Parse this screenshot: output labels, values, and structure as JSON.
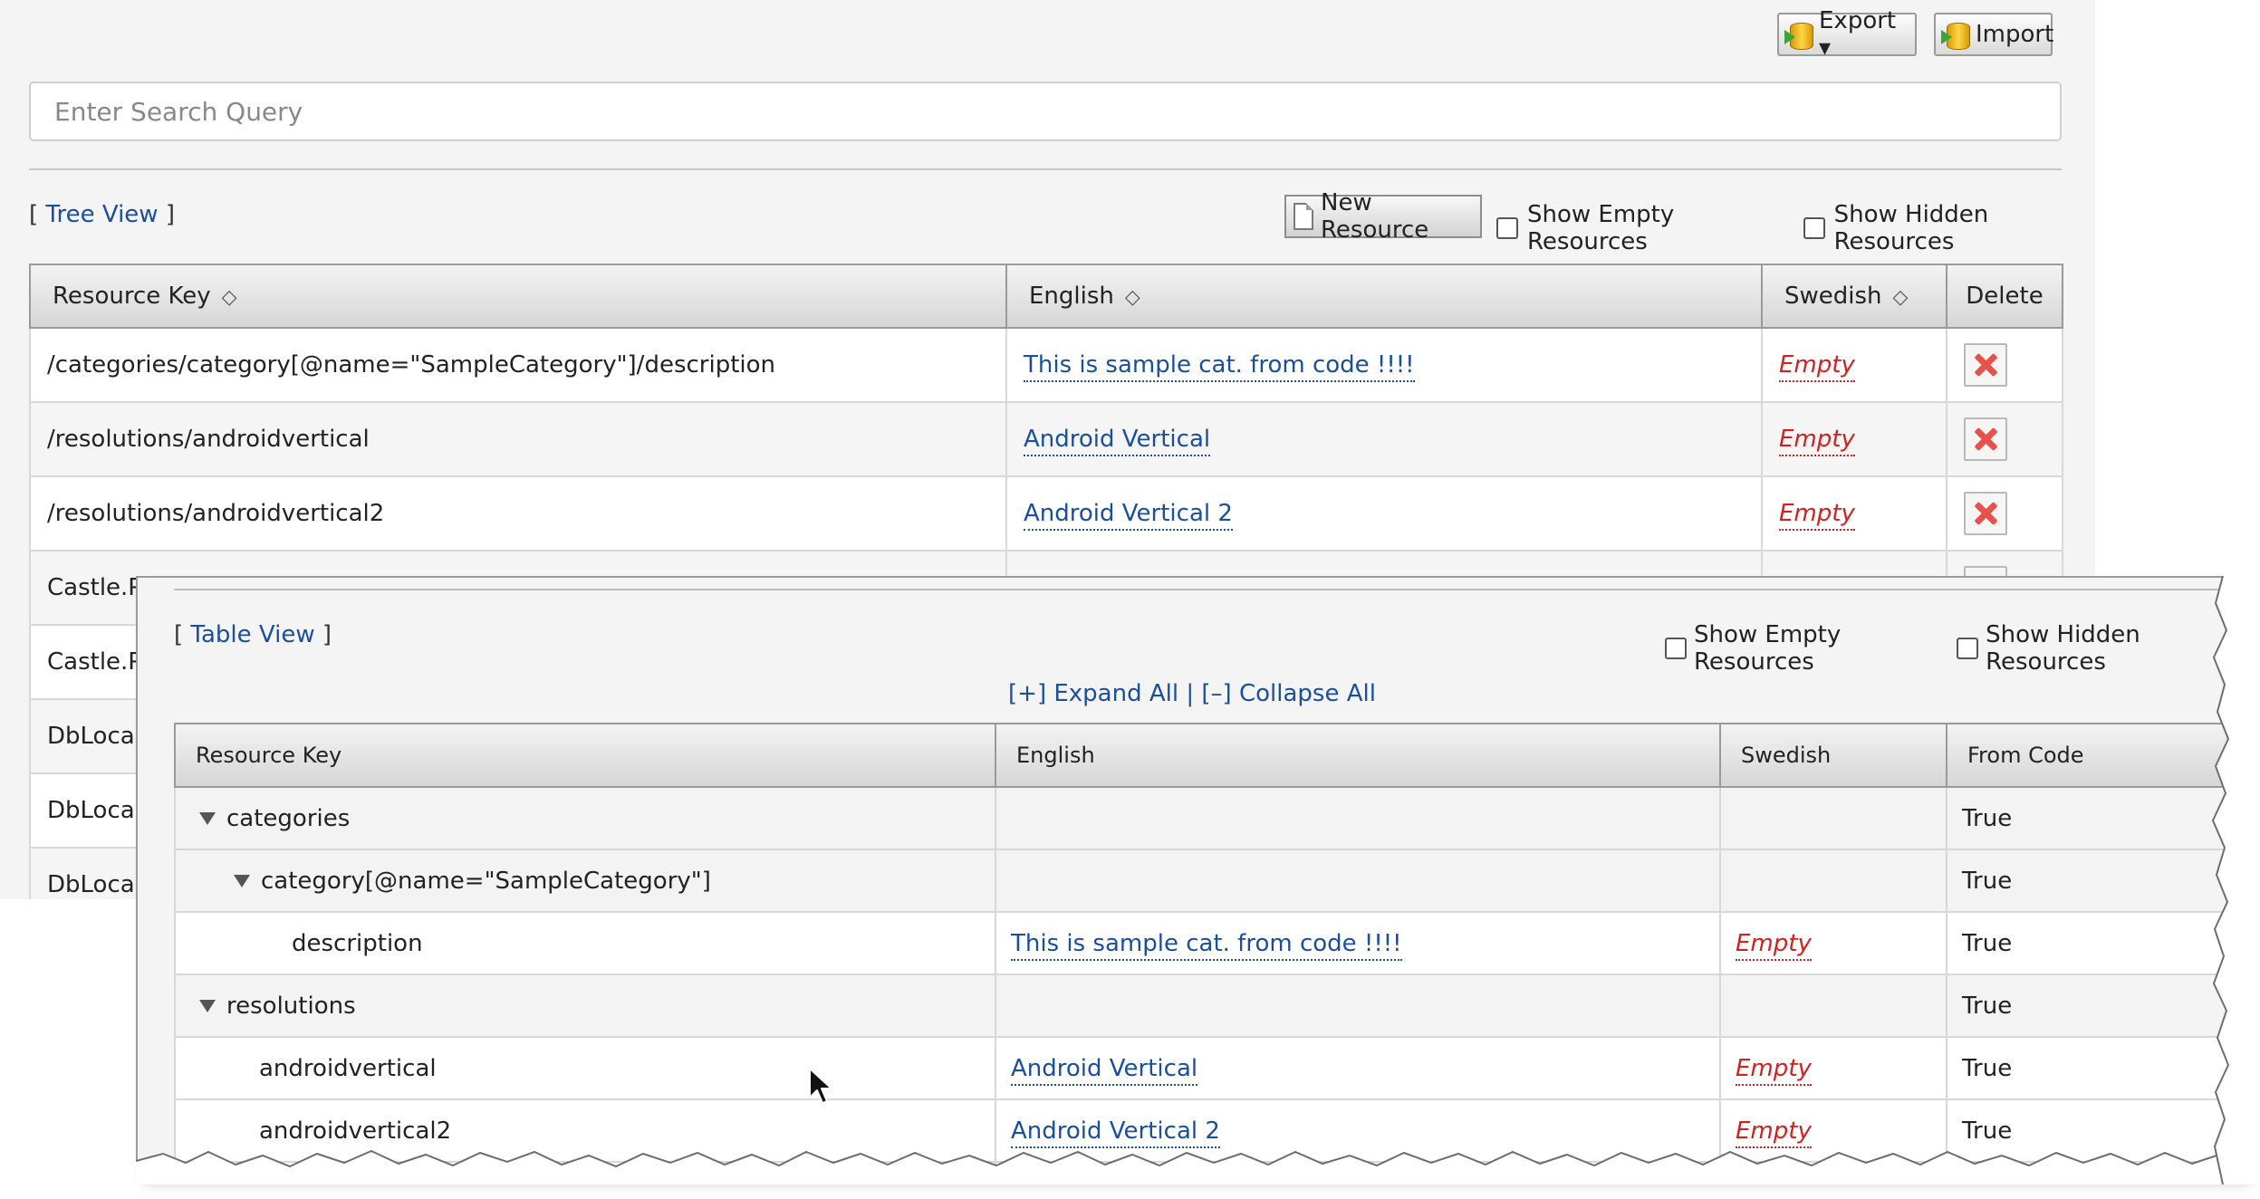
{
  "toolbar": {
    "export_label": "Export ▾",
    "import_label": "Import"
  },
  "search": {
    "placeholder": "Enter Search Query",
    "value": ""
  },
  "table_view": {
    "view_link_open": "[ ",
    "view_link_label": "Tree View",
    "view_link_close": " ]",
    "new_resource_label": "New Resource",
    "show_empty_label": "Show Empty Resources",
    "show_hidden_label": "Show Hidden Resources",
    "columns": [
      "Resource Key",
      "English",
      "Swedish",
      "Delete"
    ],
    "sort_glyph": "◇",
    "rows": [
      {
        "key": "/categories/category[@name=\"SampleCategory\"]/description",
        "english": "This is sample cat. from code !!!!",
        "swedish": "Empty"
      },
      {
        "key": "/resolutions/androidvertical",
        "english": "Android Vertical",
        "swedish": "Empty"
      },
      {
        "key": "/resolutions/androidvertical2",
        "english": "Android Vertical 2",
        "swedish": "Empty"
      },
      {
        "key": "Castle.Pr",
        "english": "",
        "swedish": ""
      },
      {
        "key": "Castle.Pr",
        "english": "",
        "swedish": ""
      },
      {
        "key": "DbLocali",
        "english": "",
        "swedish": ""
      },
      {
        "key": "DbLocali",
        "english": "",
        "swedish": ""
      },
      {
        "key": "DbLocali",
        "english": "",
        "swedish": ""
      }
    ]
  },
  "tree_view": {
    "view_link_open": "[ ",
    "view_link_label": "Table View",
    "view_link_close": " ]",
    "show_empty_label": "Show Empty Resources",
    "show_hidden_label": "Show Hidden Resources",
    "expand_all": "[+] Expand All",
    "separator": " | ",
    "collapse_all": "[–] Collapse All",
    "columns": [
      "Resource Key",
      "English",
      "Swedish",
      "From Code"
    ],
    "rows": [
      {
        "key": "categories",
        "english": "",
        "swedish": "",
        "from_code": "True"
      },
      {
        "key": "category[@name=\"SampleCategory\"]",
        "english": "",
        "swedish": "",
        "from_code": "True"
      },
      {
        "key": "description",
        "english": "This is sample cat. from code !!!!",
        "swedish": "Empty",
        "from_code": "True"
      },
      {
        "key": "resolutions",
        "english": "",
        "swedish": "",
        "from_code": "True"
      },
      {
        "key": "androidvertical",
        "english": "Android Vertical",
        "swedish": "Empty",
        "from_code": "True"
      },
      {
        "key": "androidvertical2",
        "english": "Android Vertical 2",
        "swedish": "Empty",
        "from_code": "True"
      }
    ]
  },
  "colors": {
    "link": "#1a4fa0",
    "empty": "#d42020",
    "delete": "#e8504a"
  }
}
